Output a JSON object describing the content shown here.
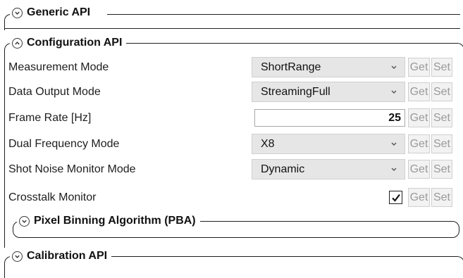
{
  "sections": {
    "generic": {
      "title": "Generic API",
      "expanded": false
    },
    "configuration": {
      "title": "Configuration API",
      "expanded": true,
      "rows": [
        {
          "label": "Measurement Mode",
          "control": "dropdown",
          "value": "ShortRange",
          "get": "Get",
          "set": "Set"
        },
        {
          "label": "Data Output Mode",
          "control": "dropdown",
          "value": "StreamingFull",
          "get": "Get",
          "set": "Set"
        },
        {
          "label": "Frame Rate [Hz]",
          "control": "number",
          "value": "25",
          "get": "Get",
          "set": "Set"
        },
        {
          "label": "Dual Frequency Mode",
          "control": "dropdown",
          "value": "X8",
          "get": "Get",
          "set": "Set"
        },
        {
          "label": "Shot Noise Monitor Mode",
          "control": "dropdown",
          "value": "Dynamic",
          "get": "Get",
          "set": "Set"
        },
        {
          "label": "Crosstalk Monitor",
          "control": "checkbox",
          "checked": true,
          "get": "Get",
          "set": "Set"
        }
      ],
      "subsection": {
        "title": "Pixel Binning Algorithm (PBA)",
        "expanded": false
      }
    },
    "calibration": {
      "title": "Calibration API",
      "expanded": false
    }
  },
  "icons": {
    "expand": "chevron-down-icon",
    "collapse": "chevron-up-icon",
    "dropdown": "dropdown-arrow-icon",
    "check": "checkmark-icon"
  }
}
